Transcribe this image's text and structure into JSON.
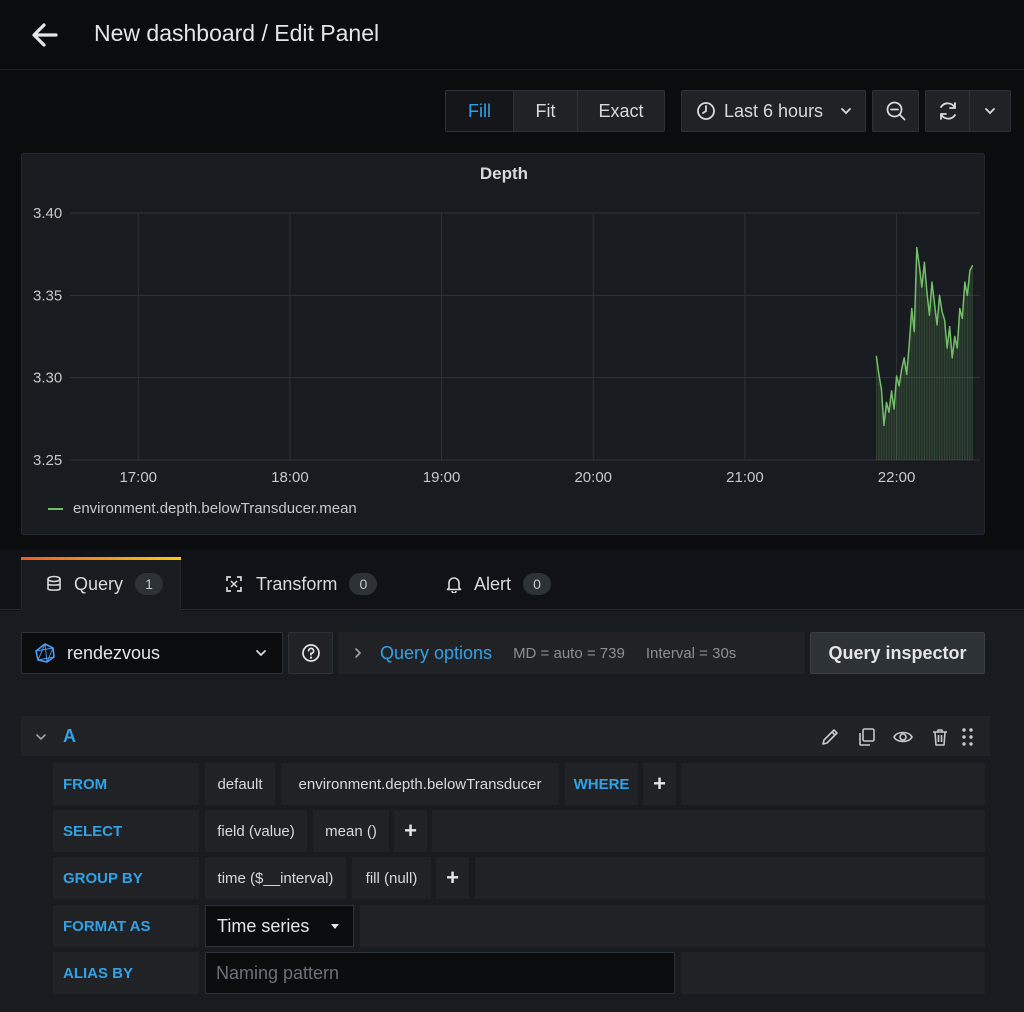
{
  "header": {
    "title": "New dashboard / Edit Panel"
  },
  "toolbar": {
    "fill": "Fill",
    "fit": "Fit",
    "exact": "Exact",
    "time_range": "Last 6 hours"
  },
  "panel": {
    "title": "Depth",
    "legend_label": "environment.depth.belowTransducer.mean"
  },
  "chart_data": {
    "type": "line",
    "title": "Depth",
    "xlabel": "",
    "ylabel": "",
    "ylim": [
      3.25,
      3.4
    ],
    "y_ticks": [
      "3.40",
      "3.35",
      "3.30",
      "3.25"
    ],
    "x_ticks": [
      "17:00",
      "18:00",
      "19:00",
      "20:00",
      "21:00",
      "22:00"
    ],
    "grid": true,
    "legend_position": "bottom-left",
    "series": [
      {
        "name": "environment.depth.belowTransducer.mean",
        "color": "#73bf69",
        "x": [
          "21:52",
          "21:53",
          "21:54",
          "21:55",
          "21:56",
          "21:57",
          "21:58",
          "21:59",
          "22:00",
          "22:01",
          "22:02",
          "22:03",
          "22:04",
          "22:05",
          "22:06",
          "22:07",
          "22:08",
          "22:09",
          "22:10",
          "22:11",
          "22:12",
          "22:13",
          "22:14",
          "22:15",
          "22:16",
          "22:17",
          "22:18",
          "22:19",
          "22:20",
          "22:21",
          "22:22",
          "22:23",
          "22:24",
          "22:25",
          "22:26",
          "22:27",
          "22:28",
          "22:29",
          "22:30"
        ],
        "values": [
          3.313,
          3.302,
          3.293,
          3.271,
          3.285,
          3.279,
          3.292,
          3.281,
          3.301,
          3.295,
          3.305,
          3.312,
          3.302,
          3.32,
          3.342,
          3.328,
          3.379,
          3.368,
          3.355,
          3.37,
          3.352,
          3.338,
          3.358,
          3.345,
          3.332,
          3.35,
          3.34,
          3.335,
          3.318,
          3.331,
          3.312,
          3.325,
          3.318,
          3.342,
          3.336,
          3.358,
          3.35,
          3.365,
          3.368
        ]
      }
    ]
  },
  "tabs": [
    {
      "label": "Query",
      "count": "1"
    },
    {
      "label": "Transform",
      "count": "0"
    },
    {
      "label": "Alert",
      "count": "0"
    }
  ],
  "datasource": {
    "name": "rendezvous"
  },
  "query_options": {
    "label": "Query options",
    "md": "MD = auto = 739",
    "interval": "Interval = 30s"
  },
  "inspector_label": "Query inspector",
  "query": {
    "ref_id": "A",
    "from": {
      "label": "FROM",
      "policy": "default",
      "measurement": "environment.depth.belowTransducer",
      "where": "WHERE"
    },
    "select": {
      "label": "SELECT",
      "field": "field (value)",
      "func": "mean ()"
    },
    "group_by": {
      "label": "GROUP BY",
      "time": "time ($__interval)",
      "fill": "fill (null)"
    },
    "format_as": {
      "label": "FORMAT AS",
      "value": "Time series"
    },
    "alias_by": {
      "label": "ALIAS BY",
      "placeholder": "Naming pattern"
    }
  }
}
